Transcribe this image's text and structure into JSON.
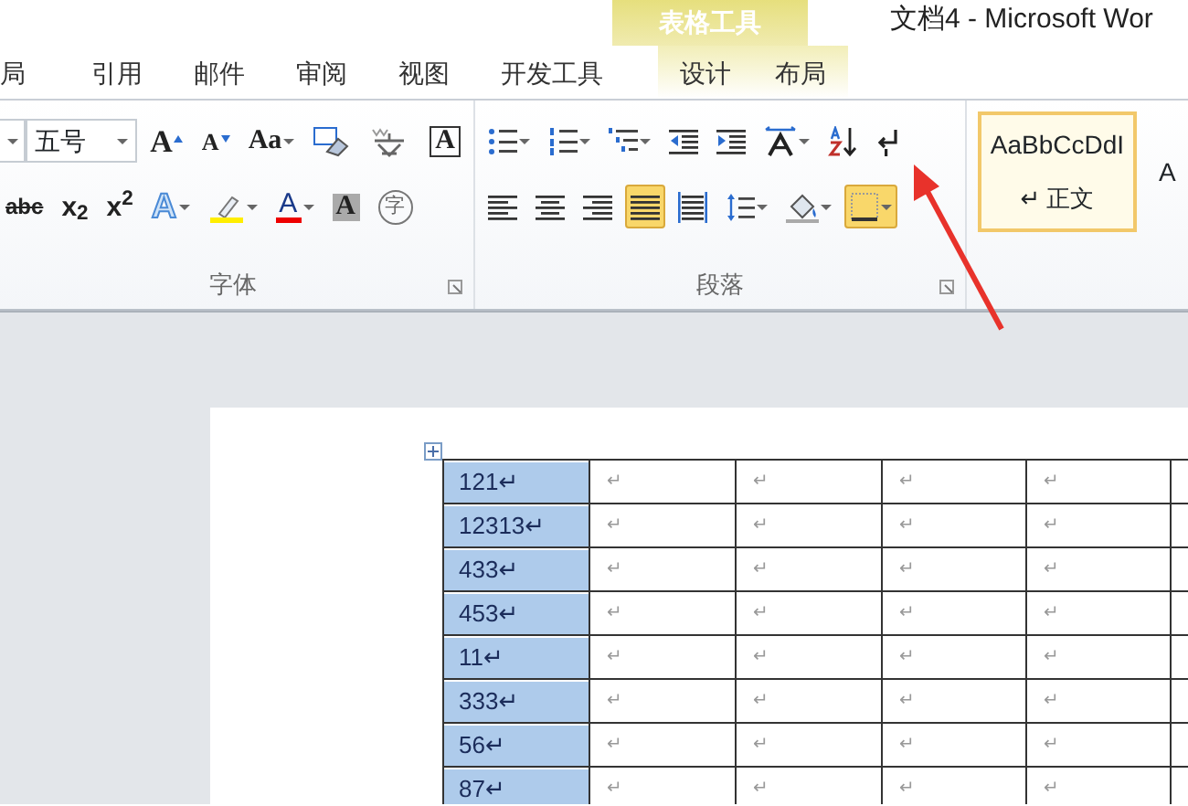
{
  "title_bar": {
    "context_group": "表格工具",
    "title": "文档4 - Microsoft Wor"
  },
  "tabs": [
    {
      "label": "局",
      "contextual": false
    },
    {
      "label": "引用",
      "contextual": false
    },
    {
      "label": "邮件",
      "contextual": false
    },
    {
      "label": "审阅",
      "contextual": false
    },
    {
      "label": "视图",
      "contextual": false
    },
    {
      "label": "开发工具",
      "contextual": false
    },
    {
      "label": "设计",
      "contextual": true
    },
    {
      "label": "布局",
      "contextual": true
    }
  ],
  "font_group": {
    "label": "字体",
    "font_size": "五号",
    "row_1": [
      {
        "kind": "grow",
        "text": "A"
      },
      {
        "kind": "shrink",
        "text": "A"
      },
      {
        "kind": "case",
        "text": "Aa",
        "dropdown": true
      },
      {
        "kind": "clear"
      },
      {
        "kind": "phonetic"
      },
      {
        "kind": "border",
        "text": "A"
      }
    ],
    "row_2": [
      {
        "kind": "strike",
        "text": "abc"
      },
      {
        "kind": "script",
        "text": "x$_{2}$"
      },
      {
        "kind": "script",
        "text": "x$^{2}$"
      },
      {
        "kind": "effect",
        "text": "A",
        "dropdown": true
      },
      {
        "kind": "highlight",
        "dropdown": true
      },
      {
        "kind": "color",
        "text": "A",
        "dropdown": true
      },
      {
        "kind": "shade",
        "text": "A"
      },
      {
        "kind": "enclose",
        "text": "字"
      }
    ]
  },
  "paragraph_group": {
    "label": "段落",
    "row_1": [
      {
        "kind": "bullets",
        "dropdown": true
      },
      {
        "kind": "numbering",
        "dropdown": true
      },
      {
        "kind": "multilevel",
        "dropdown": true
      },
      {
        "kind": "outdent",
        "dropdown": false
      },
      {
        "kind": "indent",
        "dropdown": false
      },
      {
        "kind": "layout",
        "dropdown": true
      },
      {
        "kind": "sort",
        "dropdown": false
      },
      {
        "kind": "marks",
        "dropdown": false
      }
    ],
    "row_2": [
      {
        "kind": "left",
        "selected": false,
        "dropdown": false
      },
      {
        "kind": "center",
        "selected": false,
        "dropdown": false
      },
      {
        "kind": "right",
        "selected": false,
        "dropdown": false
      },
      {
        "kind": "justify",
        "selected": true,
        "dropdown": false
      },
      {
        "kind": "distribute",
        "selected": false,
        "dropdown": false
      },
      {
        "kind": "spacing",
        "selected": false,
        "dropdown": true
      },
      {
        "kind": "fill",
        "selected": false,
        "dropdown": true
      },
      {
        "kind": "borders",
        "selected": true,
        "dropdown": true
      }
    ]
  },
  "styles": [
    {
      "preview": "AaBbCcDdI",
      "name": "↵ 正文",
      "selected": true
    },
    {
      "preview": "A",
      "selected": false
    }
  ],
  "table": {
    "columns": [
      {
        "selected": true
      },
      {
        "selected": false
      },
      {
        "selected": false
      },
      {
        "selected": false
      },
      {
        "selected": false
      }
    ],
    "rows": [
      [
        "121↵",
        "↵",
        "↵",
        "↵",
        "↵"
      ],
      [
        "12313↵",
        "↵",
        "↵",
        "↵",
        "↵"
      ],
      [
        "433↵",
        "↵",
        "↵",
        "↵",
        "↵"
      ],
      [
        "453↵",
        "↵",
        "↵",
        "↵",
        "↵"
      ],
      [
        "11↵",
        "↵",
        "↵",
        "↵",
        "↵"
      ],
      [
        "333↵",
        "↵",
        "↵",
        "↵",
        "↵"
      ],
      [
        "56↵",
        "↵",
        "↵",
        "↵",
        "↵"
      ],
      [
        "87↵",
        "↵",
        "↵",
        "↵",
        "↵"
      ]
    ]
  }
}
